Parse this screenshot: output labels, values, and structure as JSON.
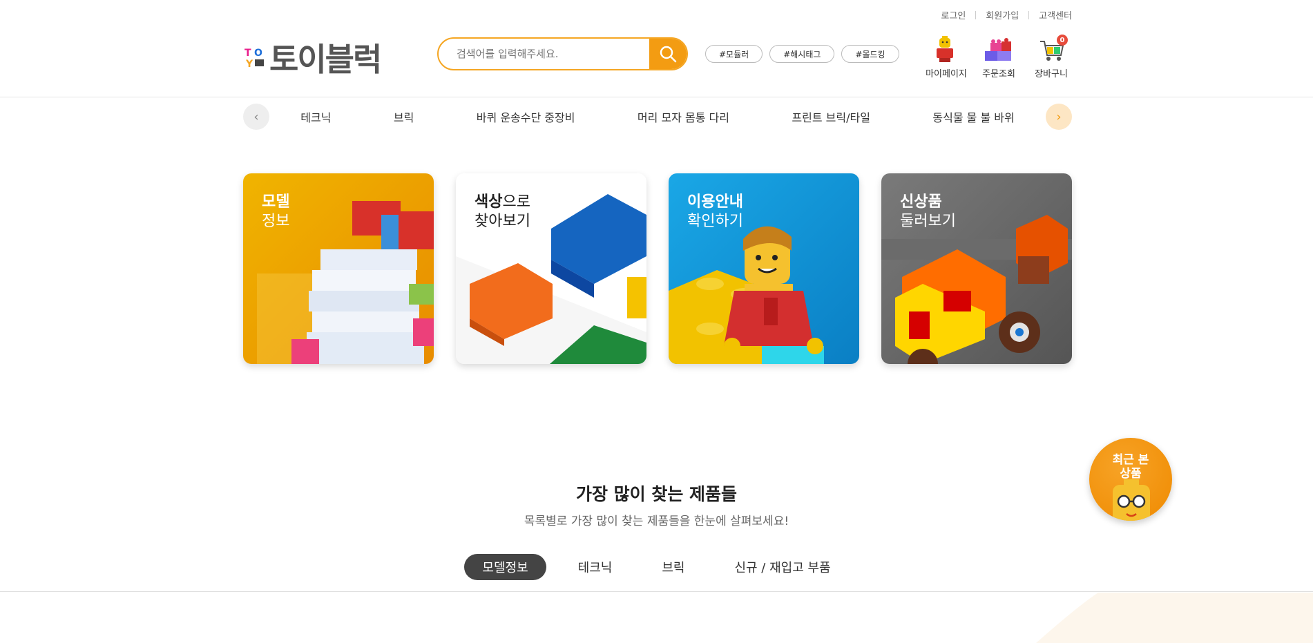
{
  "util_links": [
    "로그인",
    "회원가입",
    "고객센터"
  ],
  "logo": {
    "text": "토이블럭"
  },
  "search": {
    "placeholder": "검색어를 입력해주세요."
  },
  "hashtags": [
    "#모듈러",
    "#해시태그",
    "#몰드킹"
  ],
  "quick_links": [
    {
      "label": "마이페이지",
      "icon": "minifig-icon"
    },
    {
      "label": "주문조회",
      "icon": "bricks-icon"
    },
    {
      "label": "장바구니",
      "icon": "cart-icon",
      "badge": "0"
    }
  ],
  "categories": [
    "테크닉",
    "브릭",
    "바퀴 운송수단 중장비",
    "머리 모자 몸통 다리",
    "프린트 브릭/타일",
    "동식물 물 불 바위"
  ],
  "cards": [
    {
      "title_bold": "모델",
      "title_rest": "정보",
      "color": "#f0b400"
    },
    {
      "title_bold": "색상",
      "title_rest": "으로\n찾아보기",
      "color": "#ffffff"
    },
    {
      "title_bold": "이용안내",
      "title_rest": "확인하기",
      "color": "#1aa7e6"
    },
    {
      "title_bold": "신상품",
      "title_rest": "둘러보기",
      "color": "#6e6e6e"
    }
  ],
  "recent": {
    "label": "최근 본\n상품"
  },
  "section": {
    "title": "가장 많이 찾는 제품들",
    "subtitle": "목록별로 가장 많이 찾는 제품들을 한눈에 살펴보세요!"
  },
  "tabs": [
    "모델정보",
    "테크닉",
    "브릭",
    "신규 / 재입고 부품"
  ],
  "colors": {
    "accent": "#f39c12",
    "tab_active": "#444444",
    "badge": "#e74c3c"
  }
}
